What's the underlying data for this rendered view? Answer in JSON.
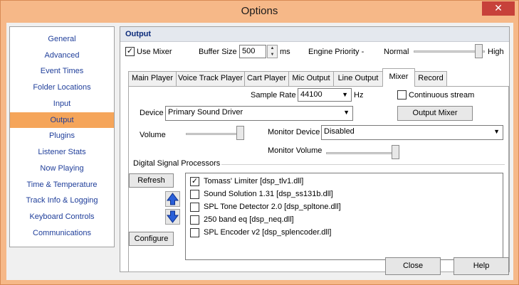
{
  "window": {
    "title": "Options",
    "close_glyph": "✕"
  },
  "sidebar": {
    "items": [
      {
        "label": "General"
      },
      {
        "label": "Advanced"
      },
      {
        "label": "Event Times"
      },
      {
        "label": "Folder Locations"
      },
      {
        "label": "Input"
      },
      {
        "label": "Output",
        "selected": true
      },
      {
        "label": "Plugins"
      },
      {
        "label": "Listener Stats"
      },
      {
        "label": "Now Playing"
      },
      {
        "label": "Time & Temperature"
      },
      {
        "label": "Track Info & Logging"
      },
      {
        "label": "Keyboard Controls"
      },
      {
        "label": "Communications"
      }
    ]
  },
  "panel": {
    "title": "Output",
    "use_mixer_label": "Use Mixer",
    "use_mixer_checked": true,
    "buffer_size_label": "Buffer Size",
    "buffer_size_value": "500",
    "buffer_size_unit": "ms",
    "engine_priority_label": "Engine Priority -",
    "engine_priority_value": "Normal",
    "engine_priority_high": "High",
    "tabs": [
      {
        "label": "Main Player"
      },
      {
        "label": "Voice Track Player"
      },
      {
        "label": "Cart Player"
      },
      {
        "label": "Mic Output"
      },
      {
        "label": "Line Output"
      },
      {
        "label": "Mixer",
        "selected": true
      },
      {
        "label": "Record"
      }
    ],
    "mixer": {
      "sample_rate_label": "Sample Rate",
      "sample_rate_value": "44100",
      "sample_rate_unit": "Hz",
      "continuous_stream_label": "Continuous stream",
      "continuous_stream_checked": false,
      "device_label": "Device",
      "device_value": "Primary Sound Driver",
      "output_mixer_button": "Output Mixer",
      "volume_label": "Volume",
      "monitor_device_label": "Monitor Device",
      "monitor_device_value": "Disabled",
      "monitor_volume_label": "Monitor Volume",
      "dsp_group_label": "Digital Signal Processors",
      "refresh_button": "Refresh",
      "configure_button": "Configure",
      "dsp_list": [
        {
          "label": "Tomass' Limiter [dsp_tlv1.dll]",
          "checked": true
        },
        {
          "label": "Sound Solution 1.31 [dsp_ss131b.dll]",
          "checked": false
        },
        {
          "label": "SPL Tone Detector 2.0 [dsp_spltone.dll]",
          "checked": false
        },
        {
          "label": "250 band eq [dsp_neq.dll]",
          "checked": false
        },
        {
          "label": "SPL Encoder v2 [dsp_splencoder.dll]",
          "checked": false
        }
      ]
    }
  },
  "footer": {
    "close_button": "Close",
    "help_button": "Help"
  },
  "colors": {
    "titlebar": "#f6b888",
    "selected_sidebar": "#f5a55a",
    "link_text": "#1f3e9a",
    "close_red": "#c7413a"
  }
}
